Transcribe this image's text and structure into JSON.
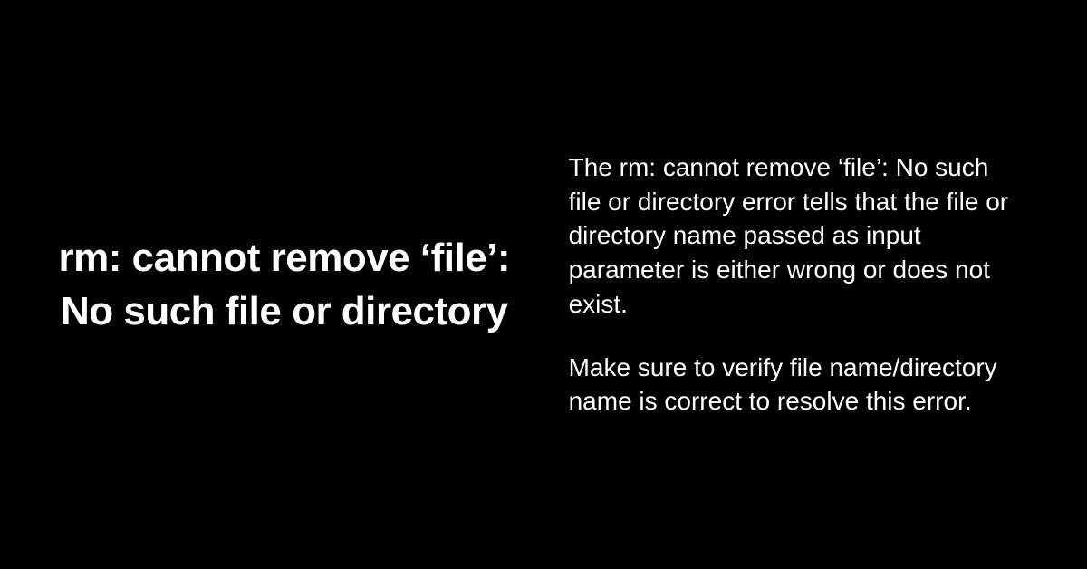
{
  "heading": "rm: cannot remove ‘file’: No such file or directory",
  "paragraph1": "The rm: cannot remove ‘file’: No such file or directory error tells that the file or directory name passed as input parameter is either wrong or does not exist.",
  "paragraph2": "Make sure to verify file name/directory name is correct to resolve this error."
}
